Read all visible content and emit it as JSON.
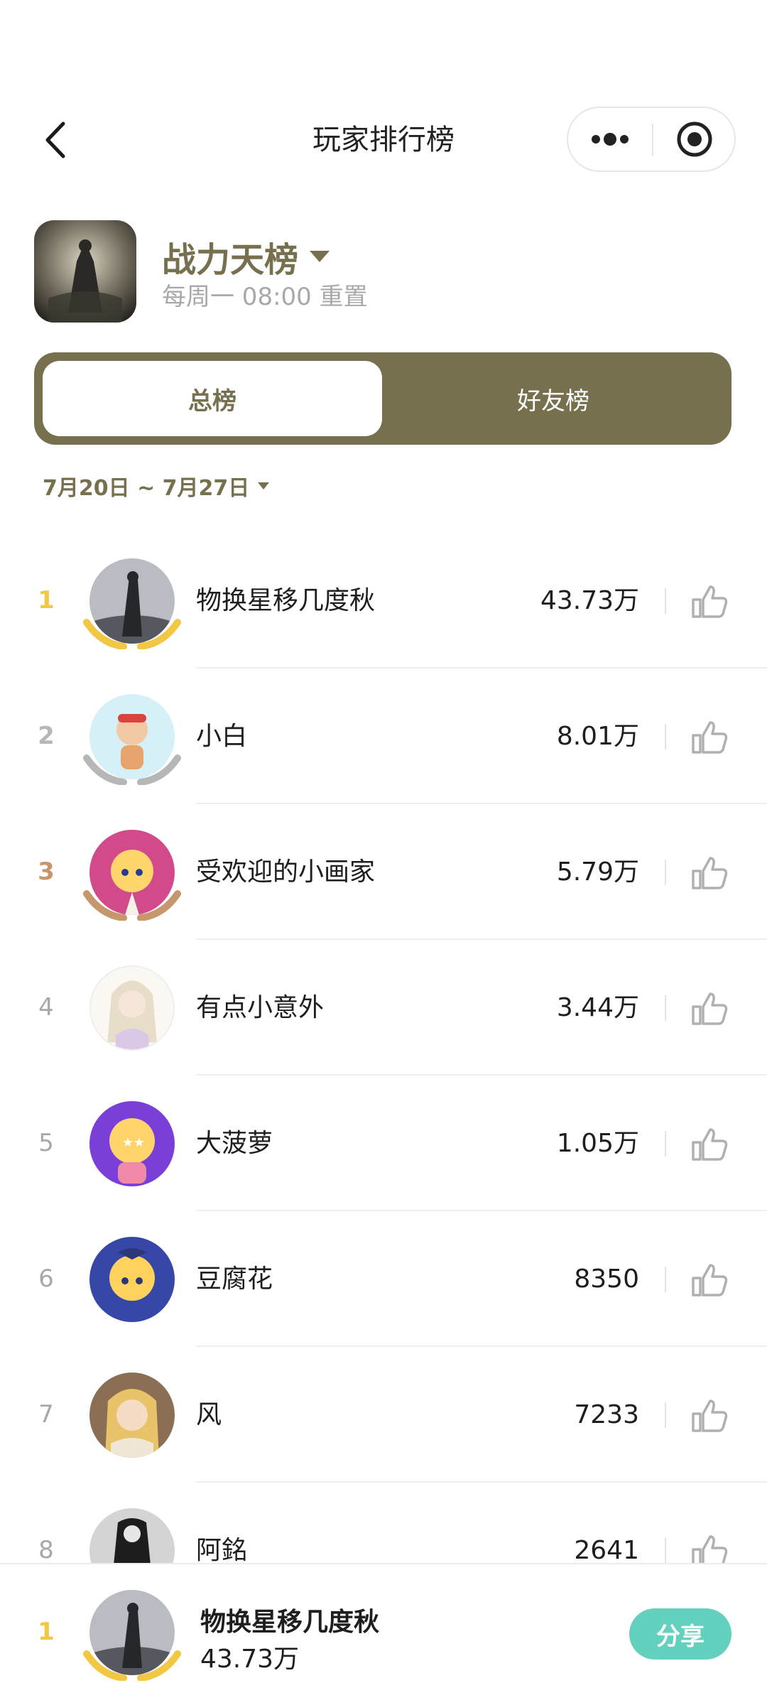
{
  "nav": {
    "title": "玩家排行榜"
  },
  "game": {
    "board_name": "战力天榜",
    "reset_text": "每周一 08:00 重置"
  },
  "tabs": {
    "overall": "总榜",
    "friends": "好友榜"
  },
  "date_range": "7月20日 ~ 7月27日",
  "rows": [
    {
      "rank": "1",
      "name": "物换星移几度秋",
      "score": "43.73万"
    },
    {
      "rank": "2",
      "name": "小白",
      "score": "8.01万"
    },
    {
      "rank": "3",
      "name": "受欢迎的小画家",
      "score": "5.79万"
    },
    {
      "rank": "4",
      "name": "有点小意外",
      "score": "3.44万"
    },
    {
      "rank": "5",
      "name": "大菠萝",
      "score": "1.05万"
    },
    {
      "rank": "6",
      "name": "豆腐花",
      "score": "8350"
    },
    {
      "rank": "7",
      "name": "风",
      "score": "7233"
    },
    {
      "rank": "8",
      "name": "阿銘",
      "score": "2641"
    }
  ],
  "me": {
    "rank": "1",
    "name": "物换星移几度秋",
    "score": "43.73万",
    "share_label": "分享"
  },
  "colors": {
    "accent": "#77704f",
    "gold": "#f2c744",
    "silver": "#b7b7b7",
    "bronze": "#c6976c",
    "share": "#63d1bd"
  },
  "icons": [
    "back-icon",
    "more-icon",
    "target-icon",
    "caret-down-icon",
    "thumbs-up-icon",
    "laurel-icon"
  ]
}
